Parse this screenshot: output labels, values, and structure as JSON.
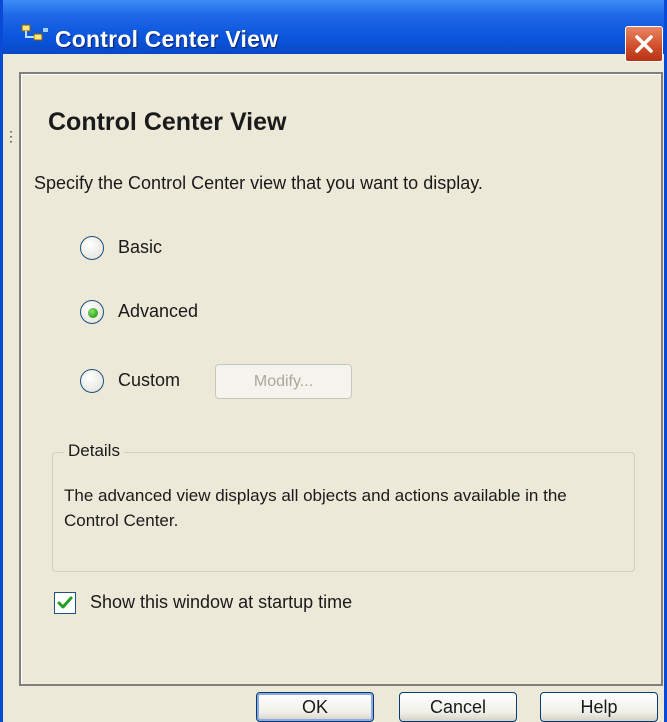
{
  "window": {
    "title": "Control Center View",
    "close_label": "Close"
  },
  "dialog": {
    "heading": "Control Center View",
    "instruction": "Specify the Control Center view that you want to display.",
    "options": [
      {
        "label": "Basic",
        "selected": false
      },
      {
        "label": "Advanced",
        "selected": true
      },
      {
        "label": "Custom",
        "selected": false
      }
    ],
    "modify_label": "Modify...",
    "details": {
      "legend": "Details",
      "text": "The advanced view displays all objects and actions available in the Control Center."
    },
    "startup_checkbox": {
      "label": "Show this window at startup time",
      "checked": true
    }
  },
  "buttons": {
    "ok": "OK",
    "cancel": "Cancel",
    "help": "Help"
  },
  "colors": {
    "titlebar": "#0a55dc",
    "dialog_bg": "#ece9d8",
    "close_button": "#d1502c",
    "radio_selected": "#3fb52a"
  },
  "icons": {
    "title": "control-center-icon",
    "close": "close-icon",
    "check": "checkmark-icon"
  }
}
